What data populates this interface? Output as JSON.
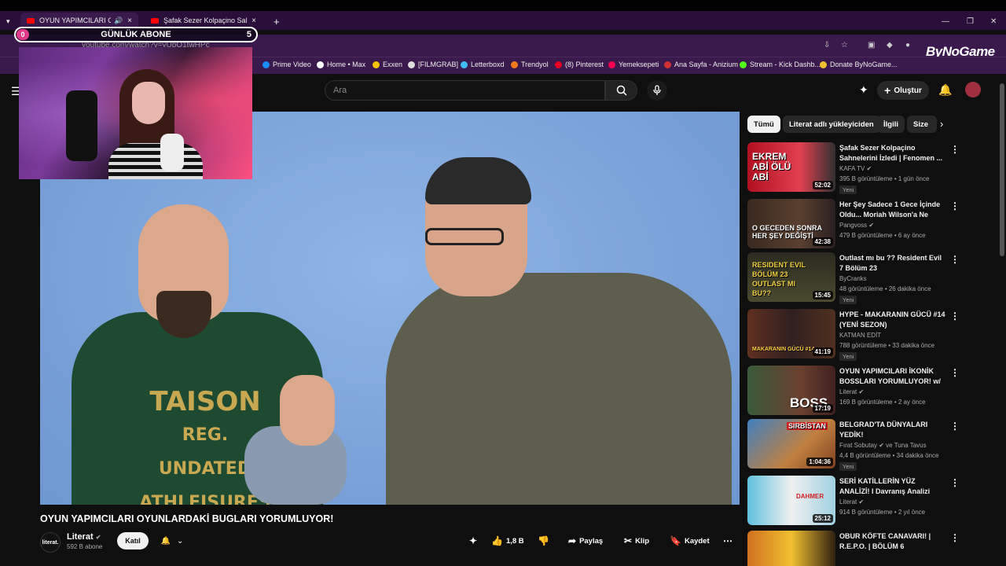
{
  "browser": {
    "tabs": [
      {
        "label": "OYUN YAPIMCILARI OYUN",
        "active": true
      },
      {
        "label": "Şafak Sezer Kolpaçino Sahneler",
        "active": false
      }
    ],
    "new_tab": "+",
    "url": "youtube.com/watch?v=yUpO1twHPc",
    "bookmarks": [
      "Prime Video",
      "Home • Max",
      "Exxen",
      "[FILMGRAB]",
      "Letterboxd",
      "Trendyol",
      "(8) Pinterest",
      "Yemeksepeti",
      "Ana Sayfa - Anizium",
      "Stream - Kick Dashb...",
      "Donate ByNoGame..."
    ],
    "brand": "ByNoGame"
  },
  "overlay": {
    "abone_label": "GÜNLÜK ABONE",
    "abone_left": "0",
    "abone_right": "5"
  },
  "header": {
    "search_placeholder": "Ara",
    "create_label": "Oluştur"
  },
  "video": {
    "title": "OYUN YAPIMCILARI OYUNLARDAKİ BUGLARI YORUMLUYOR!",
    "shirt_text": "TAISON\nREG. UNDATED\nATHLEISURES"
  },
  "channel": {
    "name": "Literat",
    "logo_text": "literat.",
    "subs": "592 B abone",
    "join": "Katıl"
  },
  "actions": {
    "likes": "1,8 B",
    "share": "Paylaş",
    "clip": "Klip",
    "save": "Kaydet"
  },
  "chips": [
    "Tümü",
    "Literat adlı yükleyiciden",
    "İlgili",
    "Size"
  ],
  "recommendations": [
    {
      "title": "Şafak Sezer Kolpaçino Sahnelerini İzledi | Fenomen ...",
      "channel": "KAFA TV",
      "meta": "395 B görüntüleme • 1 gün önce",
      "duration": "52:02",
      "new": "Yeni",
      "thumb_text": "EKREM ABİ ÖLÜ ABİ"
    },
    {
      "title": "Her Şey Sadece 1 Gece İçinde Oldu... Moriah Wilson'a Ne Oldu?",
      "channel": "Pangvoss",
      "meta": "479 B görüntüleme • 6 ay önce",
      "duration": "42:38",
      "new": "",
      "thumb_text": "O GECEDEN SONRA HER ŞEY DEĞİŞTİ"
    },
    {
      "title": "Outlast mı bu ?? Resident Evil 7 Bölüm 23",
      "channel": "ByCranks",
      "meta": "48 görüntüleme • 26 dakika önce",
      "duration": "15:45",
      "new": "Yeni",
      "thumb_text": "RESIDENT EVIL BÖLÜM 23 OUTLAST MI BU??"
    },
    {
      "title": "HYPE - MAKARANIN GÜCÜ #14 (YENİ SEZON)",
      "channel": "KATMAN EDİT",
      "meta": "788 görüntüleme • 33 dakika önce",
      "duration": "41:19",
      "new": "Yeni",
      "thumb_text": "MAKARANIN GÜCÜ #14"
    },
    {
      "title": "OYUN YAPIMCILARI İKONİK BOSSLARI YORUMLUYOR! w/ ...",
      "channel": "Literat",
      "meta": "169 B görüntüleme • 2 ay önce",
      "duration": "17:19",
      "new": "",
      "thumb_text": "BOSS"
    },
    {
      "title": "BELGRAD'TA DÜNYALARI YEDİK!",
      "channel": "Fırat Sobutay ✔ ve Tuna Tavus",
      "meta": "4,4 B görüntüleme • 34 dakika önce",
      "duration": "1:04:36",
      "new": "Yeni",
      "thumb_text": "SIRBİSTAN"
    },
    {
      "title": "SERİ KATİLLERİN YÜZ ANALİZİ! I Davranış Analizi Uzmanı",
      "channel": "Literat",
      "meta": "914 B görüntüleme • 2 yıl önce",
      "duration": "25:12",
      "new": "",
      "thumb_text": "DAHMER"
    },
    {
      "title": "OBUR KÖFTE CANAVARI! | R.E.P.O. | BÖLÜM 6",
      "channel": "",
      "meta": "",
      "duration": "",
      "new": "",
      "thumb_text": ""
    }
  ],
  "colors": {
    "accent": "#ff0000",
    "bg": "#0f0f0f",
    "chrome": "#3a1a4d"
  }
}
